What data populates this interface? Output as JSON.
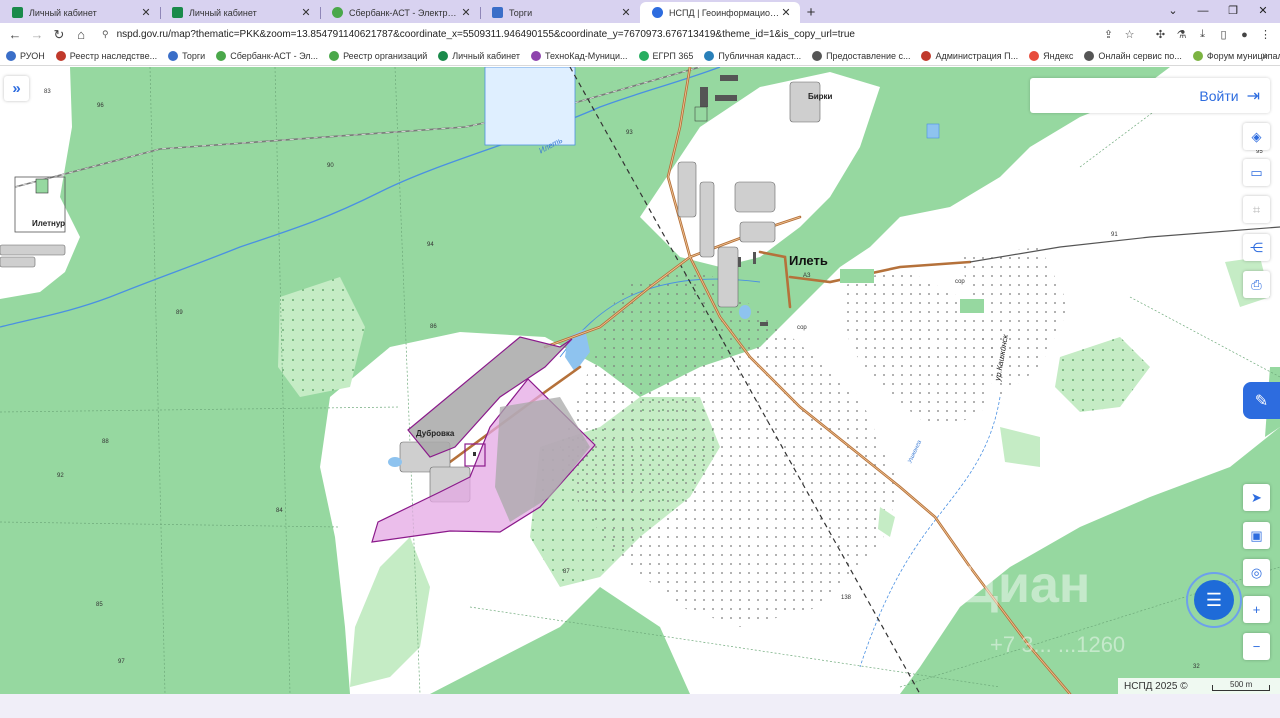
{
  "tabs": [
    {
      "title": "Личный кабинет",
      "color": "#1a8a4a",
      "active": false
    },
    {
      "title": "Личный кабинет",
      "color": "#1a8a4a",
      "active": false
    },
    {
      "title": "Сбербанк-АСТ - Электронная пло",
      "color": "#4aa84a",
      "active": false
    },
    {
      "title": "Торги",
      "color": "#3a6ec8",
      "active": false
    },
    {
      "title": "НСПД | Геоинформационный п",
      "color": "#2d6cdf",
      "active": true
    }
  ],
  "url": "nspd.gov.ru/map?thematic=PKK&zoom=13.854791140621787&coordinate_x=5509311.946490155&coordinate_y=7670973.676713419&theme_id=1&is_copy_url=true",
  "bookmarks": [
    {
      "label": "РУОН",
      "color": "#3a6ec8"
    },
    {
      "label": "Реестр наследстве...",
      "color": "#c0392b"
    },
    {
      "label": "Торги",
      "color": "#3a6ec8"
    },
    {
      "label": "Сбербанк-АСТ - Эл...",
      "color": "#4aa84a"
    },
    {
      "label": "Реестр организаций",
      "color": "#4aa84a"
    },
    {
      "label": "Личный кабинет",
      "color": "#1a8a4a"
    },
    {
      "label": "ТехноКад-Муници...",
      "color": "#8e44ad"
    },
    {
      "label": "ЕГРП 365",
      "color": "#27ae60"
    },
    {
      "label": "Публичная кадаст...",
      "color": "#2980b9"
    },
    {
      "label": "Предоставление с...",
      "color": "#555555"
    },
    {
      "label": "Администрация П...",
      "color": "#c0392b"
    },
    {
      "label": "Яндекс",
      "color": "#e74c3c"
    },
    {
      "label": "Онлайн сервис по...",
      "color": "#555555"
    },
    {
      "label": "Форум муниципал...",
      "color": "#7cb342"
    }
  ],
  "map": {
    "login_label": "Войти",
    "labels": {
      "ilet": "Илеть",
      "ilet_sub": "АЗ",
      "iletnur": "Илетнур",
      "dubrovka": "Дубровка",
      "birki": "Бирки",
      "river": "Илеть",
      "street": "ур.Кашкинск",
      "stream": "Ушкенга",
      "sor1": "сор",
      "sor2": "сор"
    },
    "elevations": [
      "83",
      "93",
      "96",
      "90",
      "94",
      "89",
      "86",
      "92",
      "84",
      "97",
      "85",
      "87",
      "138",
      "91",
      "32",
      "88",
      "95"
    ],
    "footer_label": "НСПД 2025 ©",
    "scale_label": "500 m",
    "watermark": "Циан",
    "watermark_phone": "+7 3... ...1260"
  },
  "colors": {
    "accent": "#2d6cdf",
    "forest": "#96d8a0",
    "parcel_stroke": "#8b1a8b",
    "road": "#b5713a"
  }
}
